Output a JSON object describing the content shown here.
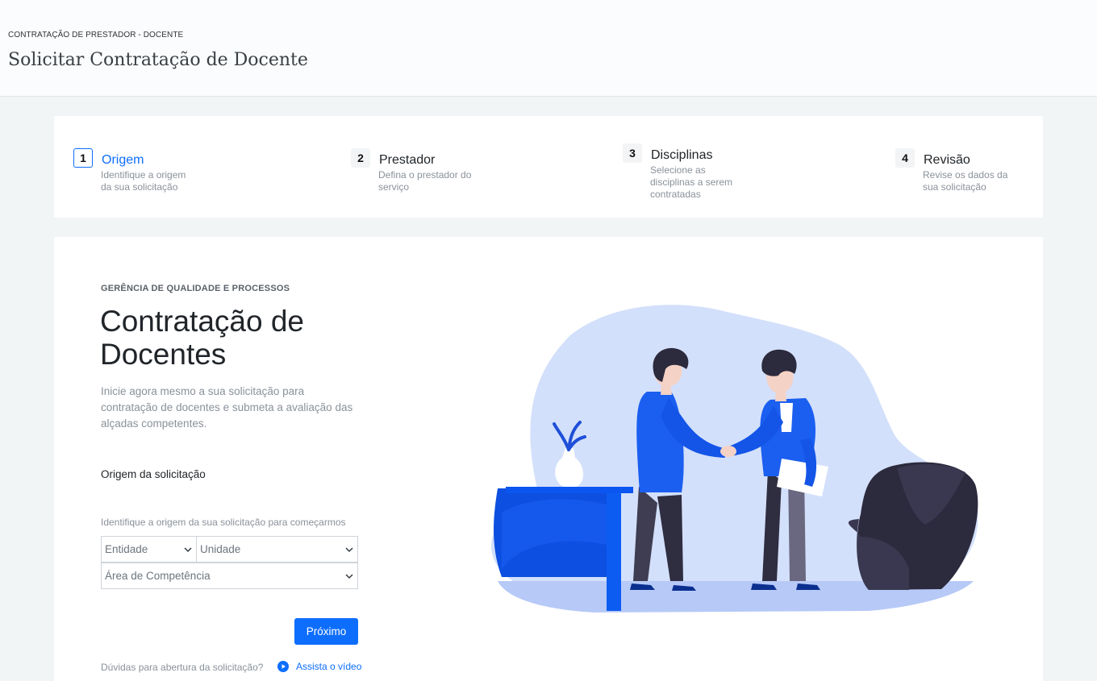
{
  "header": {
    "breadcrumb": "CONTRATAÇÃO DE PRESTADOR - DOCENTE",
    "title": "Solicitar Contratação de Docente"
  },
  "steps": [
    {
      "number": "1",
      "title": "Origem",
      "description": "Identifique a origem da sua solicitação",
      "active": true
    },
    {
      "number": "2",
      "title": "Prestador",
      "description": "Defina o prestador do serviço",
      "active": false
    },
    {
      "number": "3",
      "title": "Disciplinas",
      "description": "Selecione as disciplinas a serem contratadas",
      "active": false
    },
    {
      "number": "4",
      "title": "Revisão",
      "description": "Revise os dados da sua solicitação",
      "active": false
    }
  ],
  "main": {
    "eyebrow": "GERÊNCIA DE QUALIDADE E PROCESSOS",
    "title": "Contratação de Docentes",
    "description": "Inicie agora mesmo a sua solicitação para contratação de docentes e submeta a avaliação das alçadas competentes.",
    "field_label": "Origem da solicitação",
    "field_help": "Identifique a origem da sua solicitação para começarmos",
    "selects": {
      "entidade": "Entidade",
      "unidade": "Unidade",
      "area": "Área de Competência"
    },
    "next_button": "Próximo",
    "faq_text": "Dúvidas para abertura da solicitação?",
    "video_link": "Assista o vídeo"
  },
  "colors": {
    "accent": "#0d6efd",
    "illustration_blob": "#d3e0fb",
    "illustration_dark": "#2c2a3d"
  },
  "icons": {
    "select_arrow": "chevron-down-icon",
    "video": "play-circle-icon",
    "illustration": "handshake-illustration"
  }
}
